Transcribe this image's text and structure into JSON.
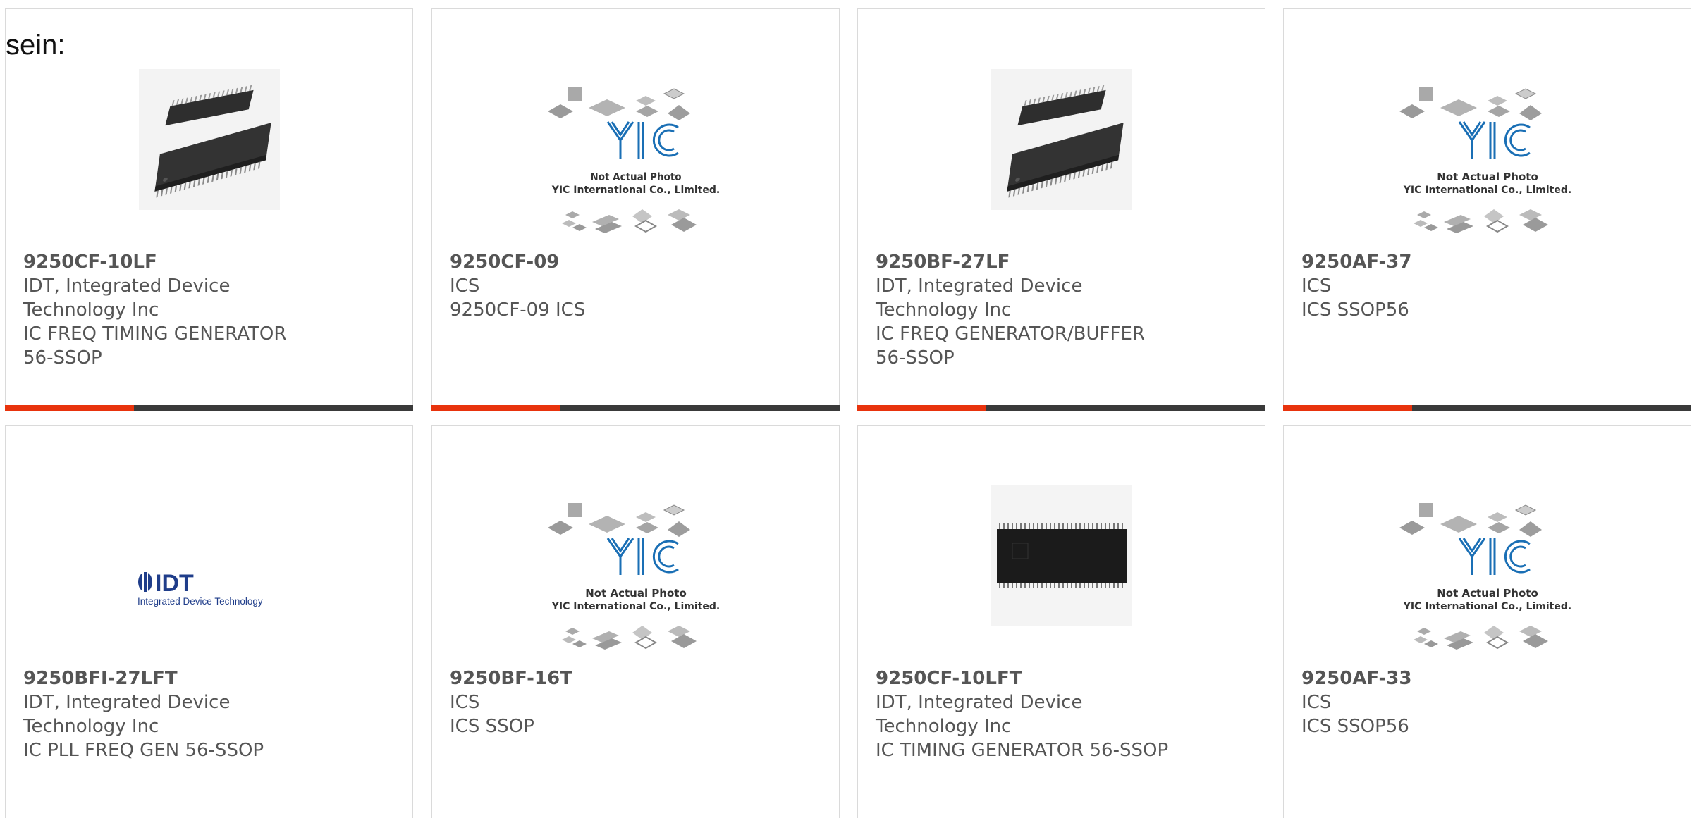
{
  "intro_text": "sein:",
  "colors": {
    "accent": "#e8330d",
    "bar_dark": "#3a3a3a",
    "text": "#555555",
    "border": "#dadada"
  },
  "products": [
    {
      "part": "9250CF-10LF",
      "mfr_line1": "IDT, Integrated Device",
      "mfr_line2": "Technology Inc",
      "desc_line1": "IC FREQ TIMING GENERATOR",
      "desc_line2": "56-SSOP",
      "image": "ssop-chip-photo"
    },
    {
      "part": "9250CF-09",
      "mfr_line1": "ICS",
      "mfr_line2": "",
      "desc_line1": "9250CF-09 ICS",
      "desc_line2": "",
      "image": "yic-placeholder"
    },
    {
      "part": "9250BF-27LF",
      "mfr_line1": "IDT, Integrated Device",
      "mfr_line2": "Technology Inc",
      "desc_line1": "IC FREQ GENERATOR/BUFFER",
      "desc_line2": "56-SSOP",
      "image": "ssop-chip-photo"
    },
    {
      "part": "9250AF-37",
      "mfr_line1": "ICS",
      "mfr_line2": "",
      "desc_line1": "ICS SSOP56",
      "desc_line2": "",
      "image": "yic-placeholder"
    },
    {
      "part": "9250BFI-27LFT",
      "mfr_line1": "IDT, Integrated Device",
      "mfr_line2": "Technology Inc",
      "desc_line1": "IC PLL FREQ GEN 56-SSOP",
      "desc_line2": "",
      "image": "idt-logo"
    },
    {
      "part": "9250BF-16T",
      "mfr_line1": "ICS",
      "mfr_line2": "",
      "desc_line1": "ICS SSOP",
      "desc_line2": "",
      "image": "yic-placeholder"
    },
    {
      "part": "9250CF-10LFT",
      "mfr_line1": "IDT, Integrated Device",
      "mfr_line2": "Technology Inc",
      "desc_line1": "IC TIMING GENERATOR 56-SSOP",
      "desc_line2": "",
      "image": "chip-top-photo"
    },
    {
      "part": "9250AF-33",
      "mfr_line1": "ICS",
      "mfr_line2": "",
      "desc_line1": "ICS SSOP56",
      "desc_line2": "",
      "image": "yic-placeholder"
    }
  ],
  "placeholder": {
    "line1": "Not Actual Photo",
    "line2": "YIC International Co., Limited."
  },
  "idt_logo": {
    "word": "IDT",
    "tagline": "Integrated Device Technology"
  }
}
